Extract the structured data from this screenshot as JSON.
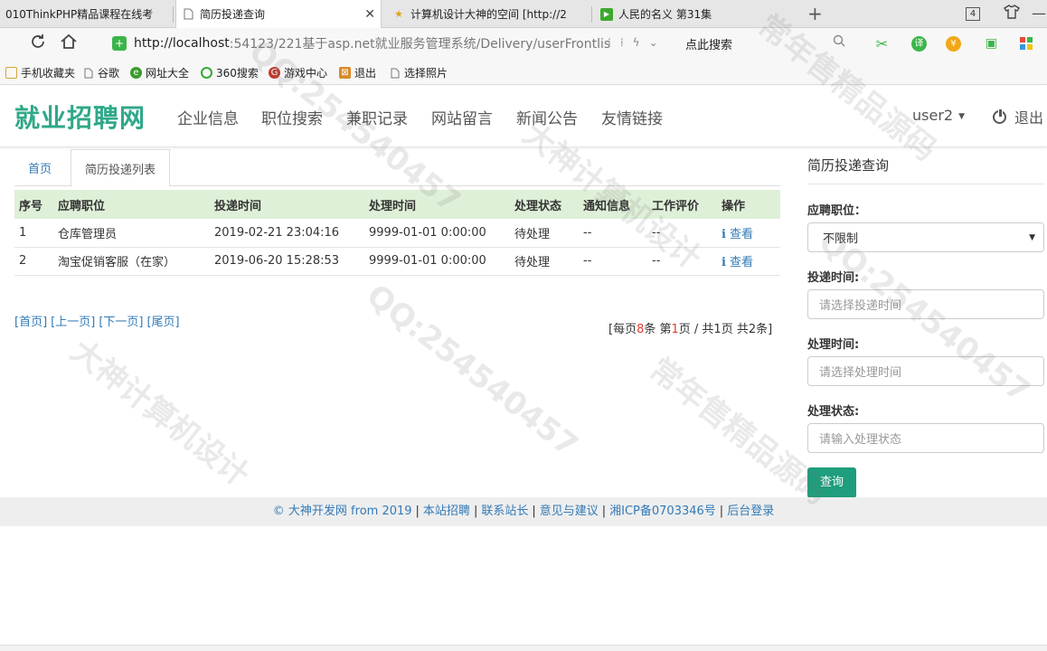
{
  "browser": {
    "tabs": [
      {
        "title": "010ThinkPHP精品课程在线考",
        "icon": "",
        "active": false
      },
      {
        "title": "简历投递查询",
        "icon": "page",
        "active": true
      },
      {
        "title": "计算机设计大神的空间 [http://2",
        "icon": "star",
        "active": false
      },
      {
        "title": "人民的名义 第31集",
        "icon": "video",
        "active": false
      }
    ],
    "tab_count": "4",
    "url_host": "http://localhost",
    "url_rest": ":54123/221基于asp.net就业服务管理系统/Delivery/userFrontlis",
    "search_label": "点此搜索",
    "bookmarks": [
      {
        "label": "手机收藏夹",
        "color": "#d9a43b"
      },
      {
        "label": "谷歌",
        "color": "#999999"
      },
      {
        "label": "网址大全",
        "color": "#3b9a2c"
      },
      {
        "label": "360搜索",
        "color": "#36a836"
      },
      {
        "label": "游戏中心",
        "color": "#c0392b"
      },
      {
        "label": "退出",
        "color": "#d98a2b"
      },
      {
        "label": "选择照片",
        "color": "#999999"
      }
    ]
  },
  "site": {
    "logo": "就业招聘网",
    "nav": [
      "企业信息",
      "职位搜索",
      "兼职记录",
      "网站留言",
      "新闻公告",
      "友情链接"
    ],
    "user": "user2",
    "logout": "退出",
    "brand_color": "#2fa889"
  },
  "content": {
    "tabs": {
      "home": "首页",
      "current": "简历投递列表"
    },
    "table": {
      "headers": [
        "序号",
        "应聘职位",
        "投递时间",
        "处理时间",
        "处理状态",
        "通知信息",
        "工作评价",
        "操作"
      ],
      "rows": [
        {
          "no": "1",
          "position": "仓库管理员",
          "submit_time": "2019-02-21 23:04:16",
          "handle_time": "9999-01-01 0:00:00",
          "status": "待处理",
          "notice": "--",
          "review": "--",
          "action": "查看"
        },
        {
          "no": "2",
          "position": "淘宝促销客服（在家）",
          "submit_time": "2019-06-20 15:28:53",
          "handle_time": "9999-01-01 0:00:00",
          "status": "待处理",
          "notice": "--",
          "review": "--",
          "action": "查看"
        }
      ]
    },
    "pager": {
      "first": "[首页]",
      "prev": "[上一页]",
      "next": "[下一页]",
      "last": "[尾页]",
      "info_open": "[每页",
      "per_page": "8",
      "info_per_suffix": "条 第",
      "current_page": "1",
      "info_page_suffix": "页 / 共1页 共2条]"
    }
  },
  "search_panel": {
    "title": "简历投递查询",
    "position_label": "应聘职位：",
    "position_value": "不限制",
    "submit_time_label": "投递时间:",
    "submit_time_placeholder": "请选择投递时间",
    "handle_time_label": "处理时间:",
    "handle_time_placeholder": "请选择处理时间",
    "status_label": "处理状态:",
    "status_placeholder": "请输入处理状态",
    "query_button": "查询"
  },
  "footer": {
    "copyright": "© 大神开发网 from 2019",
    "links": [
      "本站招聘",
      "联系站长",
      "意见与建议",
      "湘ICP备0703346号",
      "后台登录"
    ]
  },
  "watermark": {
    "texts": [
      "QQ:254540457",
      "大神计算机设计",
      "常年售精品源码"
    ]
  }
}
